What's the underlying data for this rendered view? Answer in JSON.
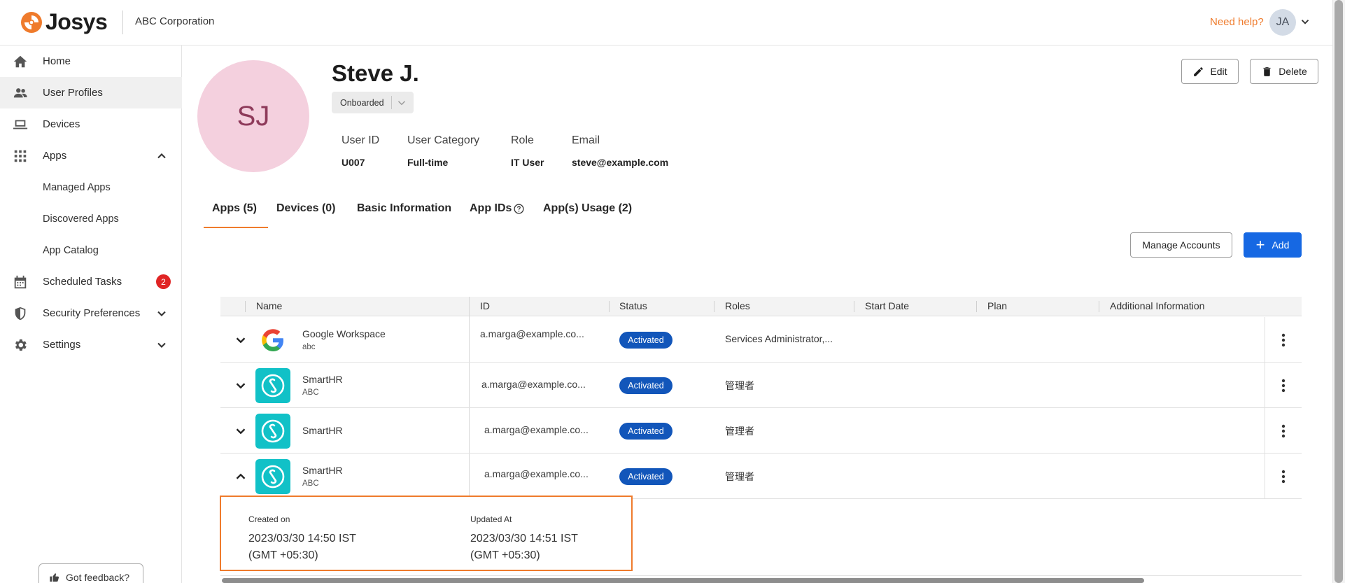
{
  "brand": {
    "name": "Josys",
    "org": "ABC Corporation",
    "accent": "#ef7b2c"
  },
  "header": {
    "help_label": "Need help?",
    "user_initials": "JA"
  },
  "sidebar": {
    "items": [
      {
        "label": "Home",
        "icon": "home-icon"
      },
      {
        "label": "User Profiles",
        "icon": "users-icon"
      },
      {
        "label": "Devices",
        "icon": "laptop-icon"
      },
      {
        "label": "Apps",
        "icon": "apps-grid-icon"
      },
      {
        "label": "Managed Apps"
      },
      {
        "label": "Discovered Apps"
      },
      {
        "label": "App Catalog"
      },
      {
        "label": "Scheduled Tasks",
        "icon": "calendar-icon",
        "badge": "2"
      },
      {
        "label": "Security Preferences",
        "icon": "shield-icon"
      },
      {
        "label": "Settings",
        "icon": "gear-icon"
      }
    ],
    "feedback_label": "Got feedback?"
  },
  "profile": {
    "initials": "SJ",
    "name": "Steve J.",
    "status": "Onboarded",
    "fields": [
      {
        "key": "User ID",
        "value": "U007"
      },
      {
        "key": "User Category",
        "value": "Full-time"
      },
      {
        "key": "Role",
        "value": "IT User"
      },
      {
        "key": "Email",
        "value": "steve@example.com"
      }
    ],
    "edit_label": "Edit",
    "delete_label": "Delete"
  },
  "tabs": [
    {
      "label": "Apps (5)",
      "active": true
    },
    {
      "label": "Devices (0)"
    },
    {
      "label": "Basic Information"
    },
    {
      "label": "App IDs"
    },
    {
      "label": "App(s) Usage (2)"
    }
  ],
  "actions": {
    "manage_label": "Manage Accounts",
    "add_label": "Add"
  },
  "table": {
    "columns": [
      "Name",
      "ID",
      "Status",
      "Roles",
      "Start Date",
      "Plan",
      "Additional Information"
    ],
    "rows": [
      {
        "name": "Google Workspace",
        "sub": "abc",
        "id": "a.marga@example.co...",
        "status": "Activated",
        "roles": "Services Administrator,..."
      },
      {
        "name": "SmartHR",
        "sub": "ABC",
        "id": "a.marga@example.co...",
        "status": "Activated",
        "roles": "管理者"
      },
      {
        "name": "SmartHR",
        "sub": "",
        "id": "a.marga@example.co...",
        "status": "Activated",
        "roles": "管理者"
      },
      {
        "name": "SmartHR",
        "sub": "ABC",
        "id": "a.marga@example.co...",
        "status": "Activated",
        "roles": "管理者"
      }
    ],
    "detail": {
      "created_label": "Created on",
      "created_value_1": "2023/03/30 14:50 IST",
      "created_value_2": "(GMT +05:30)",
      "updated_label": "Updated At",
      "updated_value_1": "2023/03/30 14:51 IST",
      "updated_value_2": "(GMT +05:30)"
    }
  }
}
